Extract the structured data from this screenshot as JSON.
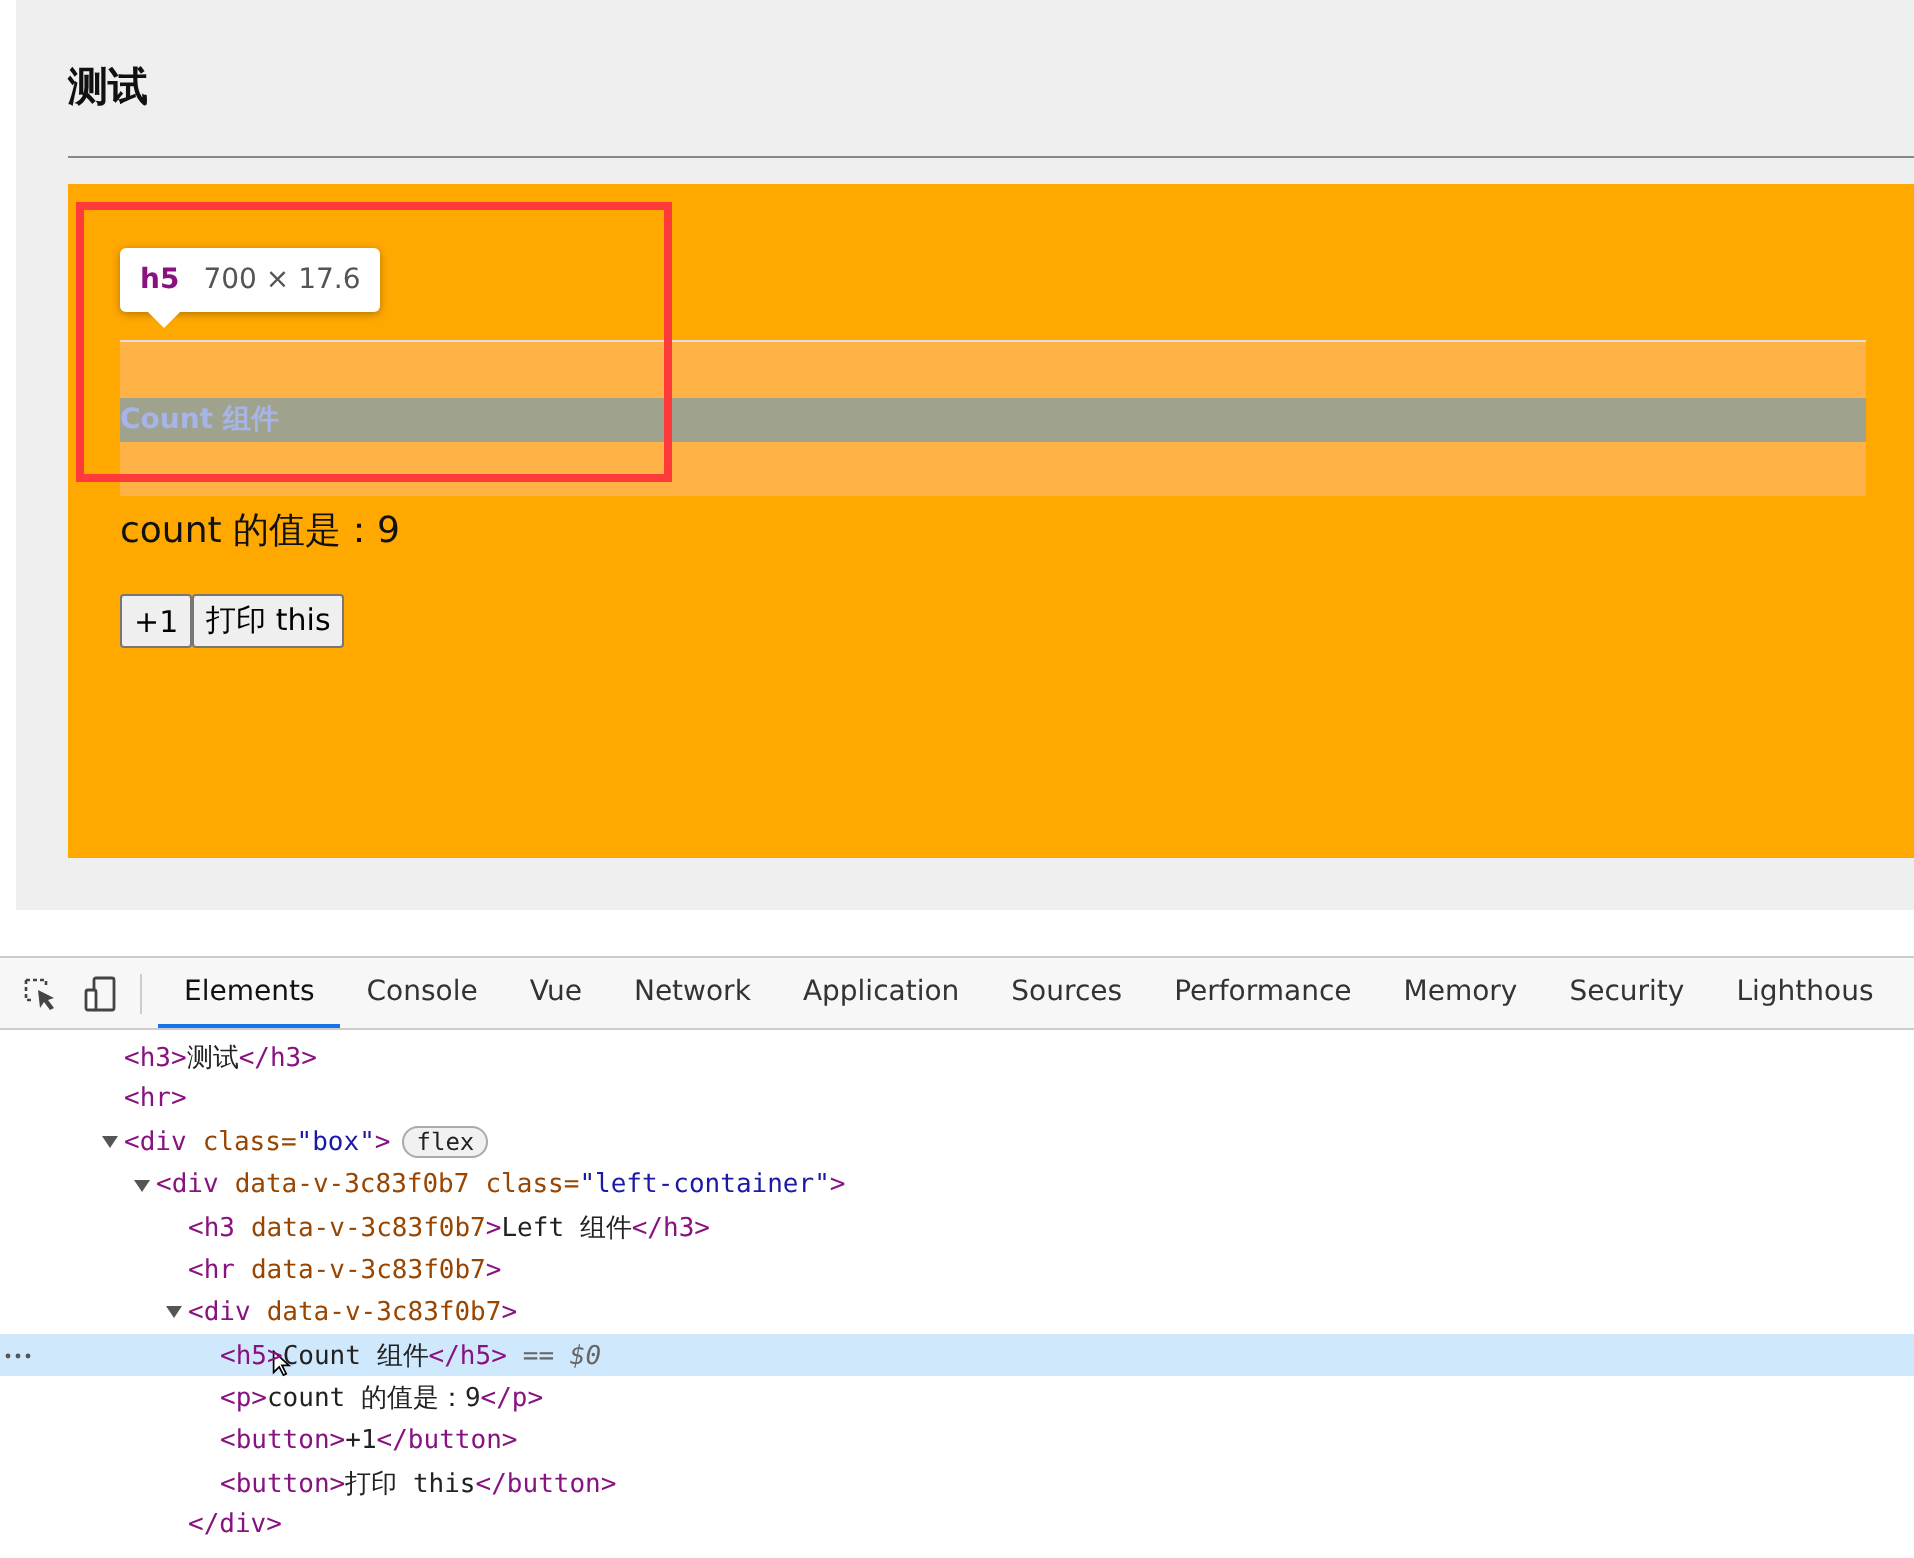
{
  "page": {
    "heading": "测试",
    "box": {
      "count_heading": "Count 组件",
      "count_text": "count 的值是：9",
      "buttons": [
        "+1",
        "打印 this"
      ]
    },
    "tooltip": {
      "tag": "h5",
      "size": "700 × 17.6"
    }
  },
  "devtools": {
    "tabs": [
      {
        "label": "Elements",
        "selected": true
      },
      {
        "label": "Console",
        "selected": false
      },
      {
        "label": "Vue",
        "selected": false
      },
      {
        "label": "Network",
        "selected": false
      },
      {
        "label": "Application",
        "selected": false
      },
      {
        "label": "Sources",
        "selected": false
      },
      {
        "label": "Performance",
        "selected": false
      },
      {
        "label": "Memory",
        "selected": false
      },
      {
        "label": "Security",
        "selected": false
      },
      {
        "label": "Lighthous",
        "selected": false
      }
    ],
    "tree": [
      {
        "tokens": [
          {
            "kind": "tag",
            "text": "<h3>"
          },
          {
            "kind": "text",
            "text": "测试"
          },
          {
            "kind": "tag",
            "text": "</h3>"
          }
        ],
        "selected": false
      },
      {
        "tokens": [
          {
            "kind": "tag",
            "text": "<hr>"
          }
        ],
        "selected": false
      },
      {
        "tokens": [
          {
            "kind": "tag",
            "text": "<div"
          },
          {
            "kind": "attr",
            "text": "class="
          },
          {
            "kind": "value",
            "text": "\"box\""
          },
          {
            "kind": "tag",
            "text": ">"
          },
          {
            "kind": "badge",
            "text": "flex"
          }
        ],
        "selected": false,
        "expanded": true,
        "children": [
          {
            "tokens": [
              {
                "kind": "tag",
                "text": "<div"
              },
              {
                "kind": "attr",
                "text": "data-v-3c83f0b7"
              },
              {
                "kind": "attr",
                "text": "class="
              },
              {
                "kind": "value",
                "text": "\"left-container\""
              },
              {
                "kind": "tag",
                "text": ">"
              }
            ],
            "selected": false,
            "expanded": true,
            "children": [
              {
                "tokens": [
                  {
                    "kind": "tag",
                    "text": "<h3"
                  },
                  {
                    "kind": "attr",
                    "text": "data-v-3c83f0b7"
                  },
                  {
                    "kind": "tag",
                    "text": ">"
                  },
                  {
                    "kind": "text",
                    "text": "Left 组件"
                  },
                  {
                    "kind": "tag",
                    "text": "</h3>"
                  }
                ],
                "selected": false
              },
              {
                "tokens": [
                  {
                    "kind": "tag",
                    "text": "<hr"
                  },
                  {
                    "kind": "attr",
                    "text": "data-v-3c83f0b7"
                  },
                  {
                    "kind": "tag",
                    "text": ">"
                  }
                ],
                "selected": false
              },
              {
                "tokens": [
                  {
                    "kind": "tag",
                    "text": "<div"
                  },
                  {
                    "kind": "attr",
                    "text": "data-v-3c83f0b7"
                  },
                  {
                    "kind": "tag",
                    "text": ">"
                  }
                ],
                "selected": false,
                "expanded": true,
                "close": "</div>",
                "children": [
                  {
                    "tokens": [
                      {
                        "kind": "tag",
                        "text": "<h5>"
                      },
                      {
                        "kind": "text",
                        "text": "Count 组件"
                      },
                      {
                        "kind": "tag",
                        "text": "</h5>"
                      },
                      {
                        "kind": "note",
                        "text": "== $0"
                      }
                    ],
                    "selected": true
                  },
                  {
                    "tokens": [
                      {
                        "kind": "tag",
                        "text": "<p>"
                      },
                      {
                        "kind": "text",
                        "text": "count 的值是：9"
                      },
                      {
                        "kind": "tag",
                        "text": "</p>"
                      }
                    ],
                    "selected": false
                  },
                  {
                    "tokens": [
                      {
                        "kind": "tag",
                        "text": "<button>"
                      },
                      {
                        "kind": "text",
                        "text": "+1"
                      },
                      {
                        "kind": "tag",
                        "text": "</button>"
                      }
                    ],
                    "selected": false
                  },
                  {
                    "tokens": [
                      {
                        "kind": "tag",
                        "text": "<button>"
                      },
                      {
                        "kind": "text",
                        "text": "打印 this"
                      },
                      {
                        "kind": "tag",
                        "text": "</button>"
                      }
                    ],
                    "selected": false
                  }
                ]
              }
            ]
          }
        ]
      }
    ]
  }
}
